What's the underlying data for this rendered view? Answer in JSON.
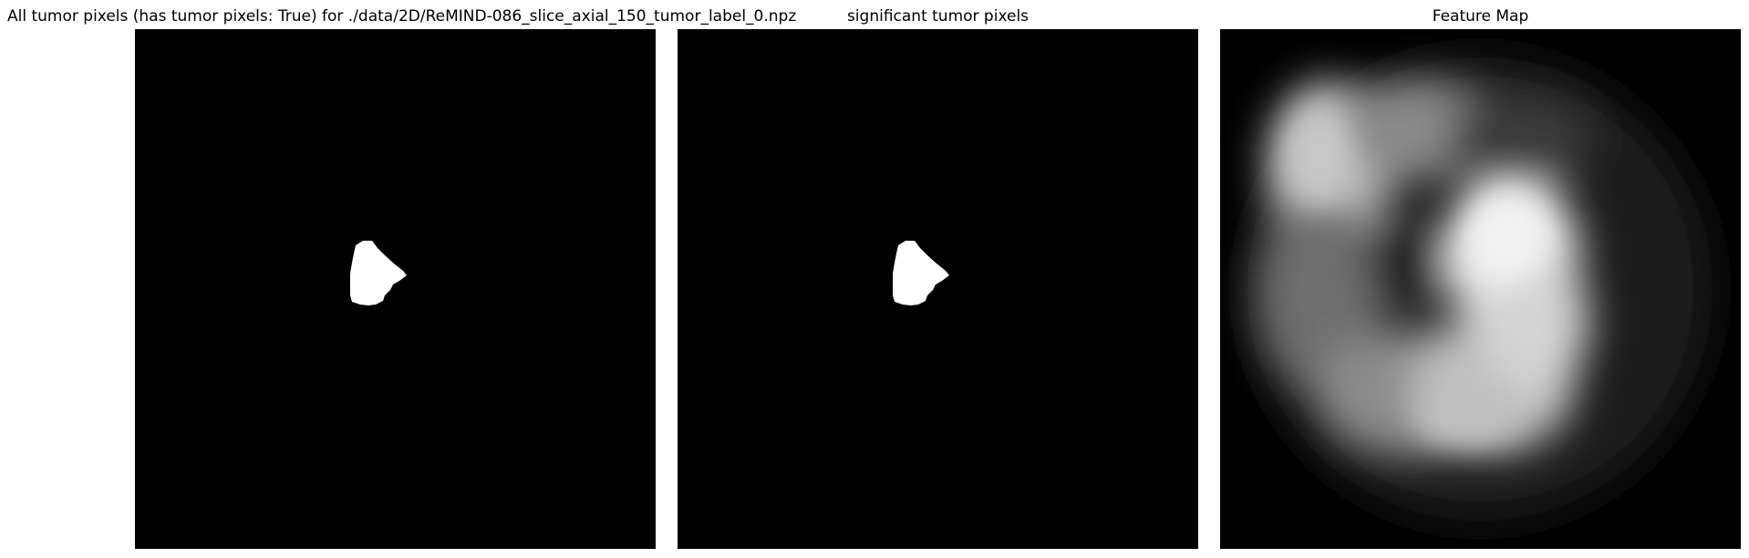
{
  "panels": [
    {
      "title": "All tumor pixels (has tumor pixels: True) for ./data/2D/ReMIND-086_slice_axial_150_tumor_label_0.npz",
      "kind": "binary-mask"
    },
    {
      "title": "significant tumor pixels",
      "kind": "binary-mask"
    },
    {
      "title": "Feature Map",
      "kind": "grayscale-heatmap"
    }
  ],
  "colors": {
    "background": "#ffffff",
    "image_background": "#000000",
    "foreground": "#ffffff"
  }
}
